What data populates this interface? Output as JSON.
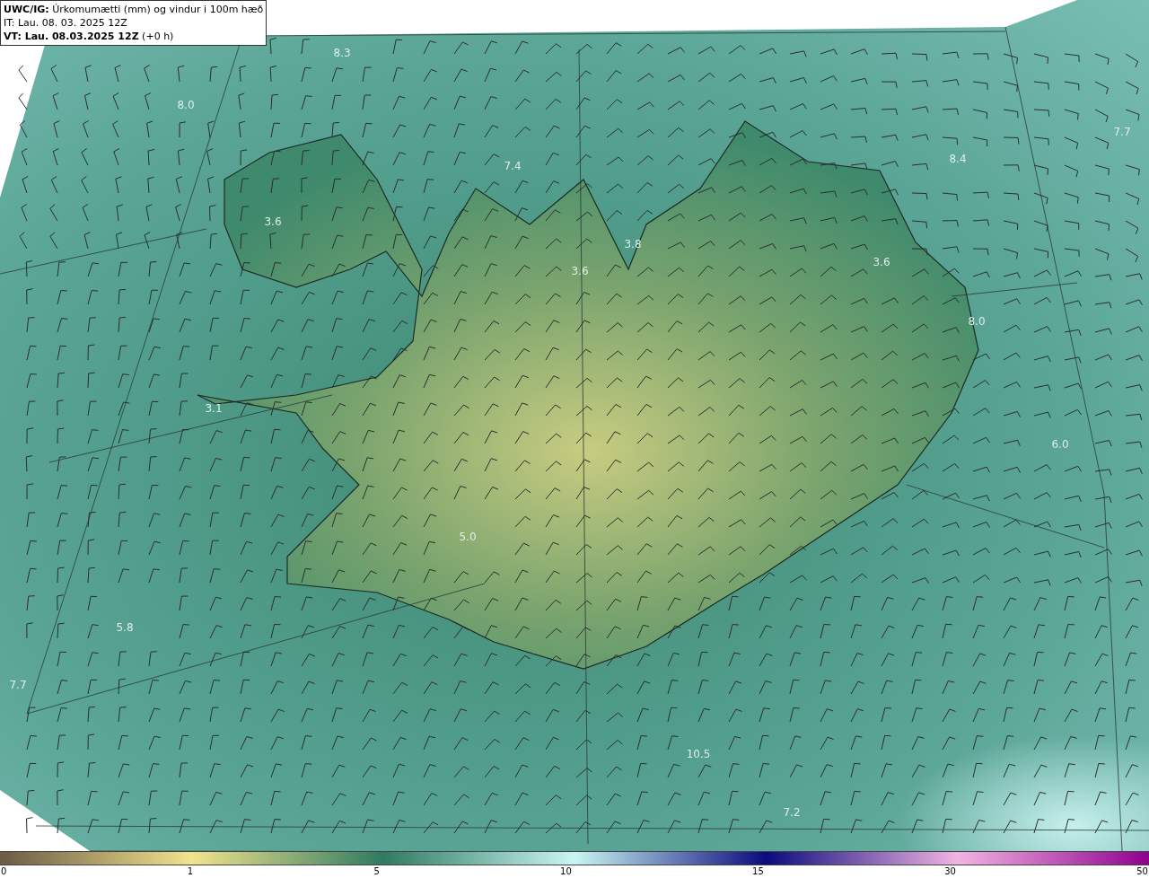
{
  "title_box": {
    "lines": [
      "**UWC/IG:** Úrkomumætti (mm) og vindur i 100m hæð",
      "IT: Lau. 08. 03. 2025 12Z",
      "**VT: Lau. 08.03.2025 12Z** (+0 h)"
    ]
  },
  "map": {
    "value_labels": [
      "8.3",
      "8.0",
      "7.4",
      "3.6",
      "3.8",
      "3.6",
      "8.4",
      "7.7",
      "3.6",
      "8.0",
      "3.1",
      "6.0",
      "5.0",
      "5.8",
      "7.7",
      "10.5",
      "7.2"
    ]
  },
  "colorbar": {
    "ticks": [
      "0",
      "1",
      "5",
      "10",
      "15",
      "30",
      "50"
    ]
  }
}
